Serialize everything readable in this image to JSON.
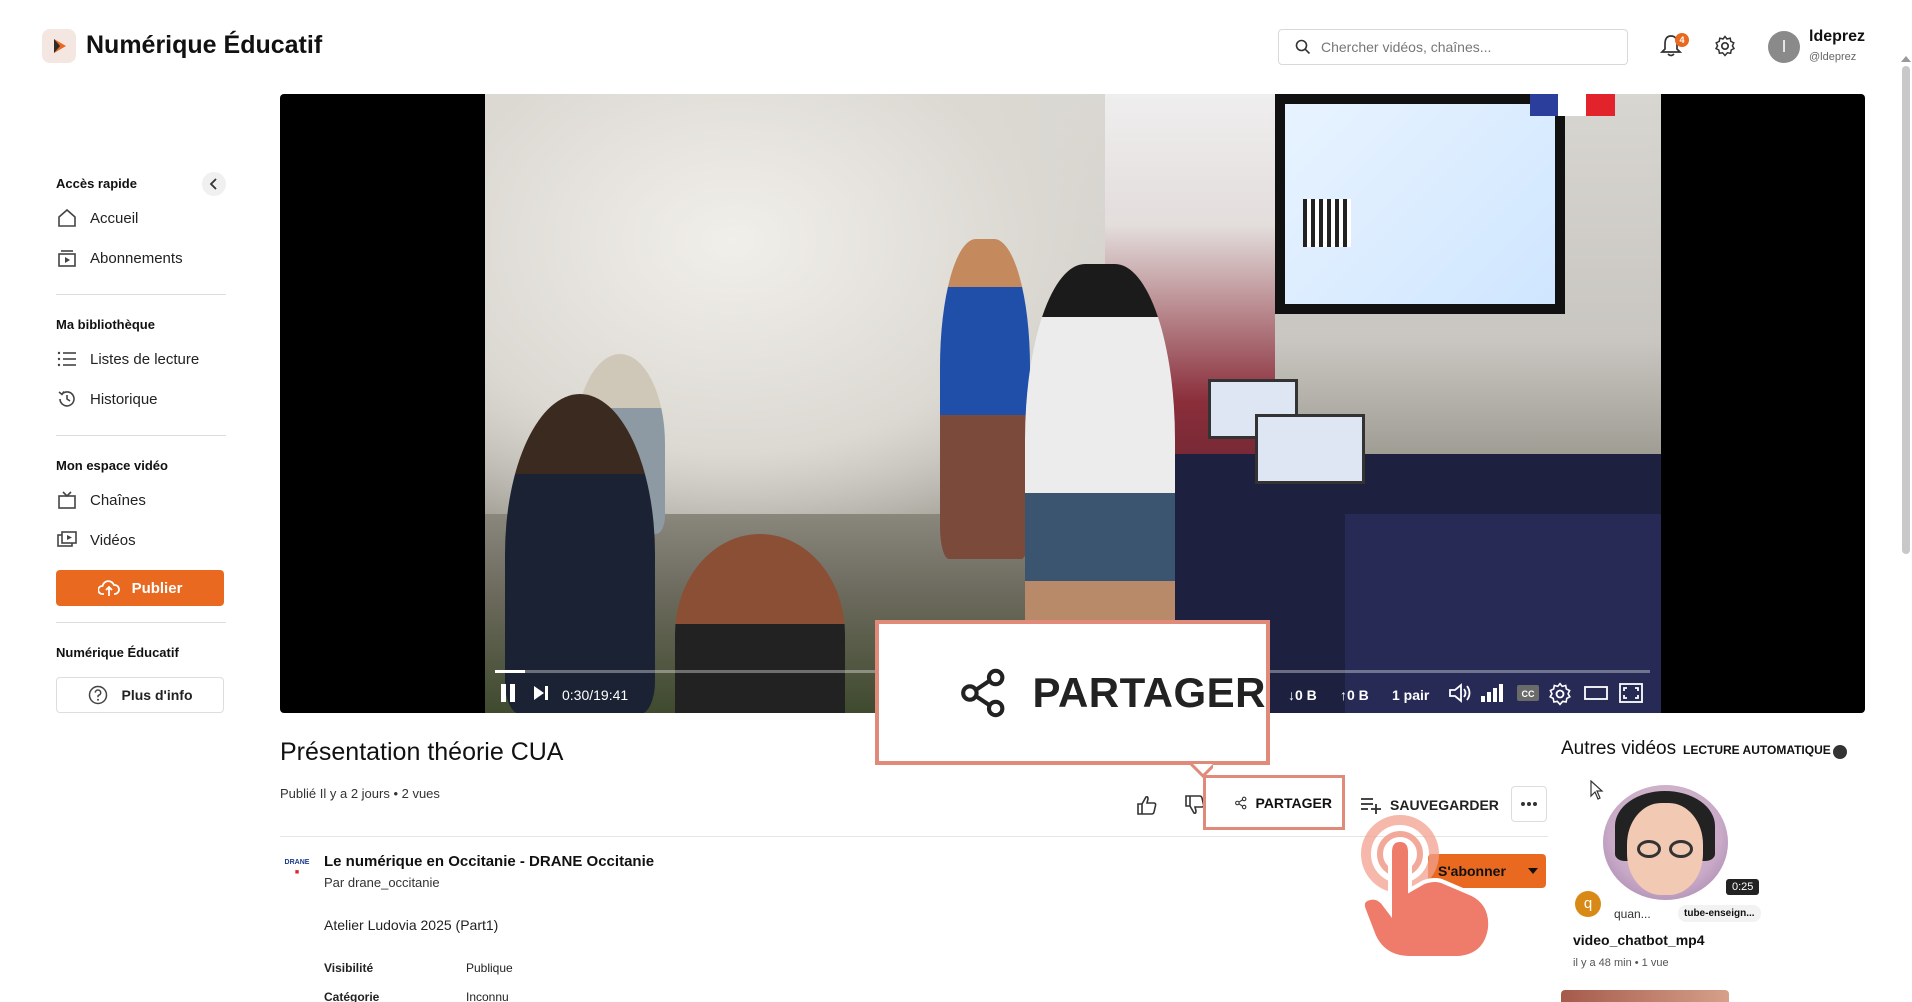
{
  "header": {
    "brand": "Numérique Éducatif",
    "search_placeholder": "Chercher vidéos, chaînes...",
    "notif_count": "4",
    "user_initial": "l",
    "user_name": "ldeprez",
    "user_handle": "@ldeprez"
  },
  "sidebar": {
    "quick_access": "Accès rapide",
    "home": "Accueil",
    "subscriptions": "Abonnements",
    "library": "Ma bibliothèque",
    "playlists": "Listes de lecture",
    "history": "Historique",
    "video_space": "Mon espace vidéo",
    "channels": "Chaînes",
    "videos": "Vidéos",
    "publish": "Publier",
    "section_brand": "Numérique Éducatif",
    "more_info": "Plus d'info"
  },
  "player": {
    "time": "0:30/19:41",
    "down": "0 B",
    "up": "0 B",
    "peers": "1 pair",
    "progress": 0.026
  },
  "video": {
    "title": "Présentation théorie CUA",
    "published": "Publié Il y a 2 jours • 2 vues",
    "share_label": "PARTAGER",
    "save_label": "SAUVEGARDER"
  },
  "channel": {
    "logo_text": "DRANE",
    "name": "Le numérique en Occitanie - DRANE Occitanie",
    "by": "Par drane_occitanie",
    "subscribe_label": "S'abonner",
    "description": "Atelier Ludovia 2025 (Part1)",
    "meta": [
      {
        "key": "Visibilité",
        "value": "Publique"
      },
      {
        "key": "Catégorie",
        "value": "Inconnu"
      }
    ]
  },
  "zoom": {
    "label": "PARTAGER"
  },
  "related": {
    "title": "Autres vidéos",
    "autoplay": "LECTURE AUTOMATIQUE",
    "items": [
      {
        "duration": "0:25",
        "avatar": "q",
        "channel": "quan...",
        "tag": "tube-enseign...",
        "title": "video_chatbot_mp4",
        "meta": "il y a 48 min • 1 vue"
      }
    ]
  }
}
